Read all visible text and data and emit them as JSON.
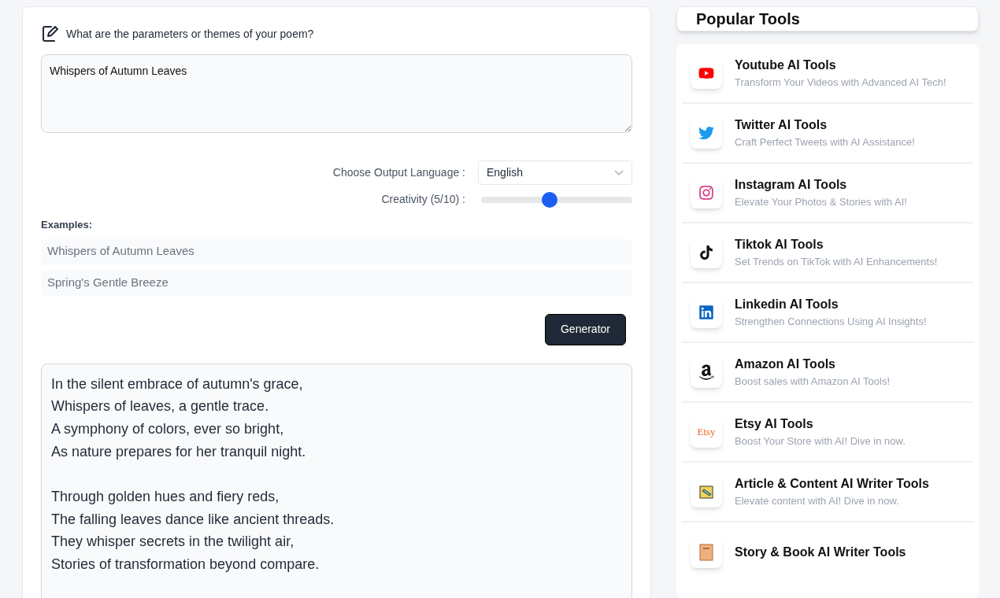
{
  "prompt": {
    "label": "What are the parameters or themes of your poem?",
    "value": "Whispers of Autumn Leaves"
  },
  "language": {
    "label": "Choose Output Language :",
    "value": "English"
  },
  "creativity": {
    "label": "Creativity (5/10) :",
    "level": 0.45
  },
  "examples": {
    "title": "Examples:",
    "items": [
      "Whispers of Autumn Leaves",
      "Spring's Gentle Breeze"
    ]
  },
  "generate_button": "Generator",
  "poem": {
    "stanzas": [
      [
        "In the silent embrace of autumn's grace,",
        "Whispers of leaves, a gentle trace.",
        "A symphony of colors, ever so bright,",
        "As nature prepares for her tranquil night."
      ],
      [
        "Through golden hues and fiery reds,",
        "The falling leaves dance like ancient threads.",
        "They whisper secrets in the twilight air,",
        "Stories of transformation beyond compare."
      ]
    ]
  },
  "popular_tools": {
    "title": "Popular Tools",
    "items": [
      {
        "kind": "youtube",
        "name": "Youtube AI Tools",
        "description": "Transform Your Videos with Advanced AI Tech!"
      },
      {
        "kind": "twitter",
        "name": "Twitter AI Tools",
        "description": "Craft Perfect Tweets with AI Assistance!"
      },
      {
        "kind": "instagram",
        "name": "Instagram AI Tools",
        "description": "Elevate Your Photos & Stories with AI!"
      },
      {
        "kind": "tiktok",
        "name": "Tiktok AI Tools",
        "description": "Set Trends on TikTok with AI Enhancements!"
      },
      {
        "kind": "linkedin",
        "name": "Linkedin AI Tools",
        "description": "Strengthen Connections Using AI Insights!"
      },
      {
        "kind": "amazon",
        "name": "Amazon AI Tools",
        "description": "Boost sales with Amazon AI Tools!"
      },
      {
        "kind": "etsy",
        "logo_text": "Etsy",
        "name": "Etsy AI Tools",
        "description": "Boost Your Store with AI! Dive in now."
      },
      {
        "kind": "article",
        "name": "Article & Content AI Writer Tools",
        "description": "Elevate content with AI! Dive in now."
      },
      {
        "kind": "story",
        "name": "Story & Book AI Writer Tools"
      }
    ]
  }
}
